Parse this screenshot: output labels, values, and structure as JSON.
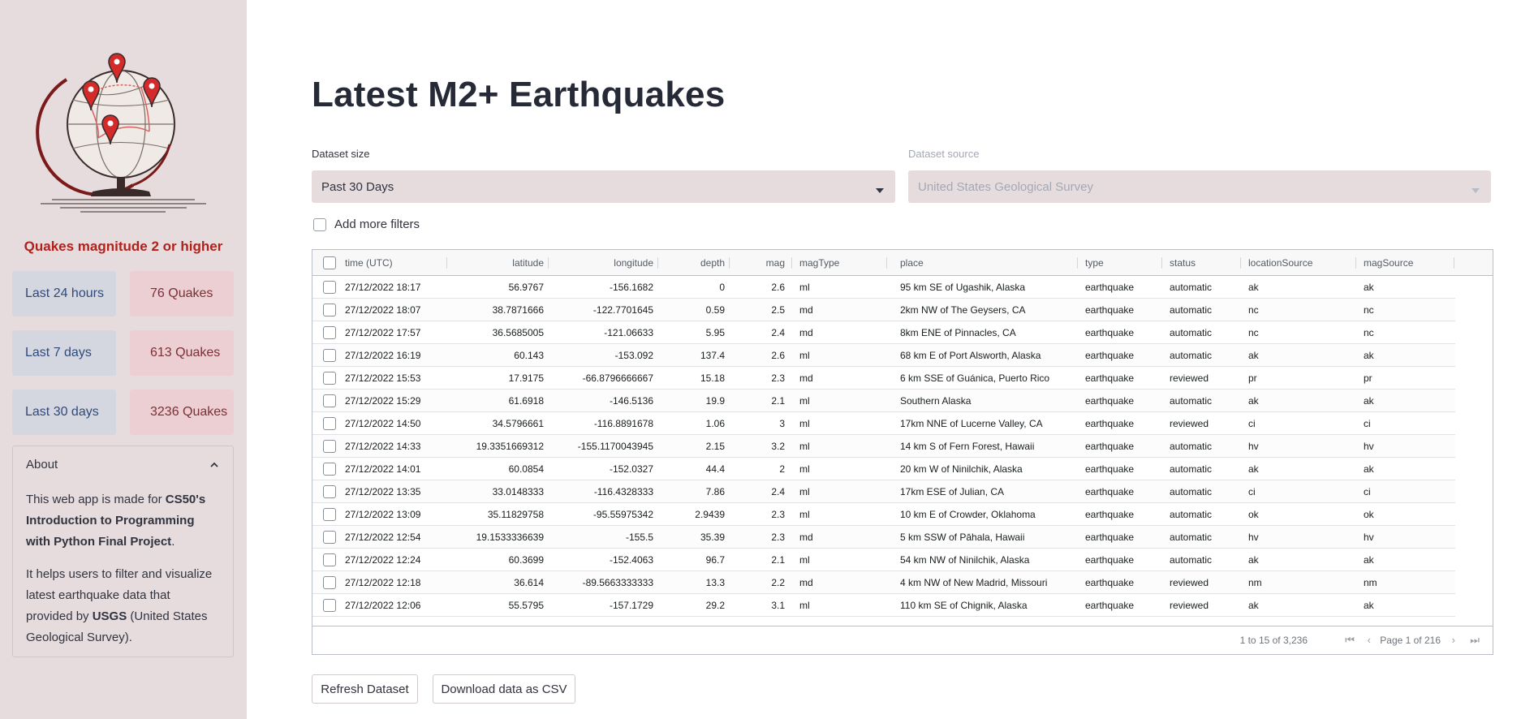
{
  "sidebar": {
    "heading": "Quakes magnitude 2 or higher",
    "stats": [
      {
        "period": "Last 24 hours",
        "count": "76 Quakes"
      },
      {
        "period": "Last 7 days",
        "count": "613 Quakes"
      },
      {
        "period": "Last 30 days",
        "count": "3236 Quakes"
      }
    ],
    "about": {
      "title": "About",
      "p1_prefix": "This web app is made for ",
      "p1_bold": "CS50's Introduction to Programming with Python Final Project",
      "p1_suffix": ".",
      "p2_prefix": "It helps users to filter and visualize latest earthquake data that provided by ",
      "p2_bold": "USGS",
      "p2_suffix": " (United States Geological Survey)."
    }
  },
  "main": {
    "title": "Latest M2+ Earthquakes",
    "dataset_size": {
      "label": "Dataset size",
      "value": "Past 30 Days"
    },
    "dataset_source": {
      "label": "Dataset source",
      "value": "United States Geological Survey"
    },
    "filters_label": "Add more filters",
    "table": {
      "columns": [
        "time (UTC)",
        "latitude",
        "longitude",
        "depth",
        "mag",
        "magType",
        "place",
        "type",
        "status",
        "locationSource",
        "magSource"
      ],
      "rows": [
        [
          "27/12/2022 18:17",
          "56.9767",
          "-156.1682",
          "0",
          "2.6",
          "ml",
          "95 km SE of Ugashik, Alaska",
          "earthquake",
          "automatic",
          "ak",
          "ak"
        ],
        [
          "27/12/2022 18:07",
          "38.7871666",
          "-122.7701645",
          "0.59",
          "2.5",
          "md",
          "2km NW of The Geysers, CA",
          "earthquake",
          "automatic",
          "nc",
          "nc"
        ],
        [
          "27/12/2022 17:57",
          "36.5685005",
          "-121.06633",
          "5.95",
          "2.4",
          "md",
          "8km ENE of Pinnacles, CA",
          "earthquake",
          "automatic",
          "nc",
          "nc"
        ],
        [
          "27/12/2022 16:19",
          "60.143",
          "-153.092",
          "137.4",
          "2.6",
          "ml",
          "68 km E of Port Alsworth, Alaska",
          "earthquake",
          "automatic",
          "ak",
          "ak"
        ],
        [
          "27/12/2022 15:53",
          "17.9175",
          "-66.8796666667",
          "15.18",
          "2.3",
          "md",
          "6 km SSE of Guánica, Puerto Rico",
          "earthquake",
          "reviewed",
          "pr",
          "pr"
        ],
        [
          "27/12/2022 15:29",
          "61.6918",
          "-146.5136",
          "19.9",
          "2.1",
          "ml",
          "Southern Alaska",
          "earthquake",
          "automatic",
          "ak",
          "ak"
        ],
        [
          "27/12/2022 14:50",
          "34.5796661",
          "-116.8891678",
          "1.06",
          "3",
          "ml",
          "17km NNE of Lucerne Valley, CA",
          "earthquake",
          "reviewed",
          "ci",
          "ci"
        ],
        [
          "27/12/2022 14:33",
          "19.3351669312",
          "-155.1170043945",
          "2.15",
          "3.2",
          "ml",
          "14 km S of Fern Forest, Hawaii",
          "earthquake",
          "automatic",
          "hv",
          "hv"
        ],
        [
          "27/12/2022 14:01",
          "60.0854",
          "-152.0327",
          "44.4",
          "2",
          "ml",
          "20 km W of Ninilchik, Alaska",
          "earthquake",
          "automatic",
          "ak",
          "ak"
        ],
        [
          "27/12/2022 13:35",
          "33.0148333",
          "-116.4328333",
          "7.86",
          "2.4",
          "ml",
          "17km ESE of Julian, CA",
          "earthquake",
          "automatic",
          "ci",
          "ci"
        ],
        [
          "27/12/2022 13:09",
          "35.11829758",
          "-95.55975342",
          "2.9439",
          "2.3",
          "ml",
          "10 km E of Crowder, Oklahoma",
          "earthquake",
          "automatic",
          "ok",
          "ok"
        ],
        [
          "27/12/2022 12:54",
          "19.1533336639",
          "-155.5",
          "35.39",
          "2.3",
          "md",
          "5 km SSW of Pāhala, Hawaii",
          "earthquake",
          "automatic",
          "hv",
          "hv"
        ],
        [
          "27/12/2022 12:24",
          "60.3699",
          "-152.4063",
          "96.7",
          "2.1",
          "ml",
          "54 km NW of Ninilchik, Alaska",
          "earthquake",
          "automatic",
          "ak",
          "ak"
        ],
        [
          "27/12/2022 12:18",
          "36.614",
          "-89.5663333333",
          "13.3",
          "2.2",
          "md",
          "4 km NW of New Madrid, Missouri",
          "earthquake",
          "reviewed",
          "nm",
          "nm"
        ],
        [
          "27/12/2022 12:06",
          "55.5795",
          "-157.1729",
          "29.2",
          "3.1",
          "ml",
          "110 km SE of Chignik, Alaska",
          "earthquake",
          "reviewed",
          "ak",
          "ak"
        ]
      ],
      "pagination_summary": "1 to 15 of 3,236",
      "page_label": "Page 1 of 216"
    },
    "buttons": {
      "refresh": "Refresh Dataset",
      "download": "Download data as CSV"
    }
  },
  "icons": {
    "logo": "globe-with-map-pins-icon",
    "about_toggle": "chevron-up-icon",
    "select_caret": "caret-down-icon",
    "first_page": "first-page-icon",
    "prev_page": "prev-page-icon",
    "next_page": "next-page-icon",
    "last_page": "last-page-icon"
  },
  "colors": {
    "sidebar_bg": "#e6dcdd",
    "accent_red": "#b0211c",
    "period_bg": "#d5d7e0",
    "count_bg": "#eccfd2",
    "title": "#262a36"
  }
}
